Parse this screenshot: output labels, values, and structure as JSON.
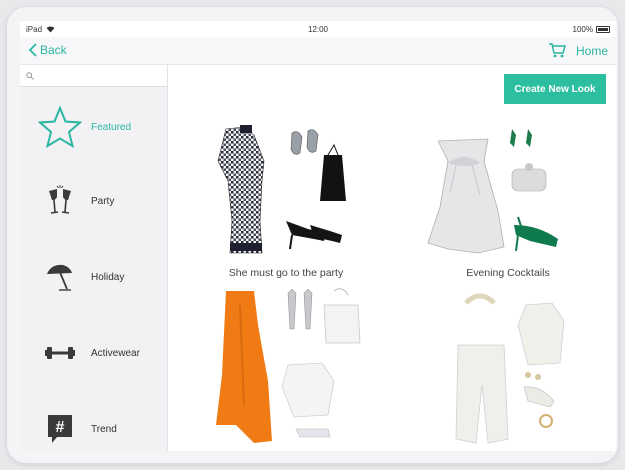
{
  "status": {
    "device": "iPad",
    "time": "12:00",
    "battery": "100%"
  },
  "nav": {
    "back_label": "Back",
    "home_label": "Home"
  },
  "search": {
    "placeholder": ""
  },
  "categories": [
    {
      "label": "Featured",
      "icon": "star-icon",
      "active": true
    },
    {
      "label": "Party",
      "icon": "champagne-glasses-icon",
      "active": false
    },
    {
      "label": "Holiday",
      "icon": "beach-umbrella-icon",
      "active": false
    },
    {
      "label": "Activewear",
      "icon": "dumbbell-icon",
      "active": false
    },
    {
      "label": "Trend",
      "icon": "hashtag-icon",
      "active": false
    }
  ],
  "main": {
    "create_label": "Create New Look"
  },
  "looks": [
    {
      "caption": "She must go to the party"
    },
    {
      "caption": "Evening Cocktails"
    },
    {
      "caption": ""
    },
    {
      "caption": ""
    }
  ],
  "colors": {
    "accent": "#2bb5a3",
    "button": "#2bbf9f"
  }
}
